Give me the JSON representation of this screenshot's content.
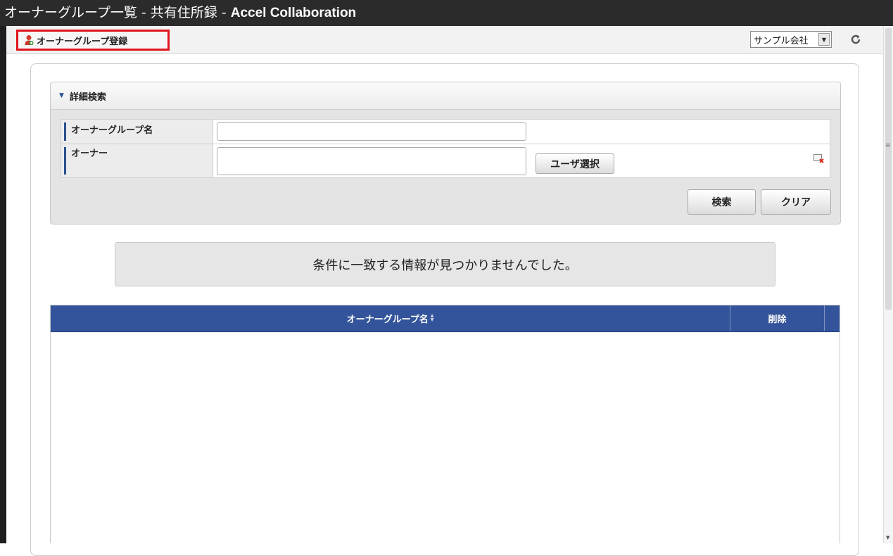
{
  "window": {
    "title_ja": "オーナーグループ一覧 - 共有住所録 - ",
    "title_en": "Accel Collaboration"
  },
  "toolbar": {
    "register_label": "オーナーグループ登録",
    "company_select": "サンプル会社",
    "icons": {
      "register": "user-group-add-icon",
      "refresh": "refresh-icon",
      "dropdown": "chevron-down-icon"
    }
  },
  "search": {
    "header": "詳細検索",
    "fields": {
      "group_name_label": "オーナーグループ名",
      "group_name_value": "",
      "owner_label": "オーナー",
      "owner_value": ""
    },
    "user_select_button": "ユーザ選択",
    "search_button": "検索",
    "clear_button": "クリア"
  },
  "message": "条件に一致する情報が見つかりませんでした。",
  "table": {
    "columns": [
      "オーナーグループ名",
      "削除"
    ],
    "rows": []
  },
  "colors": {
    "titlebar": "#2b2b2b",
    "highlight": "#e0141c",
    "table_header": "#33549a",
    "label_accent": "#2c4f8f"
  }
}
